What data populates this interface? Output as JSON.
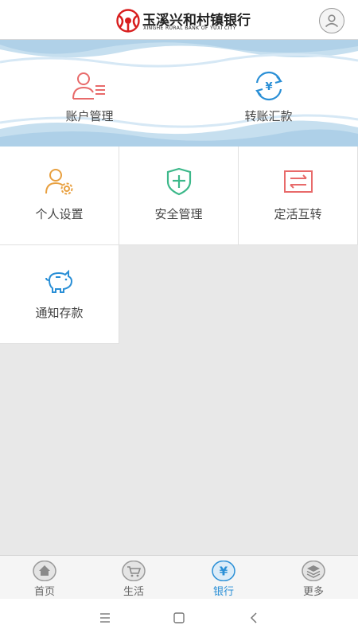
{
  "header": {
    "bank_name_cn": "玉溪兴和村镇银行",
    "bank_name_en": "XINGHE RURAL BANK OF YUXI CITY",
    "logo_icon": "bank-logo-icon",
    "avatar_icon": "user-avatar-icon"
  },
  "banner": {
    "items": [
      {
        "label": "账户管理",
        "icon": "account-card-icon",
        "color": "#e86a6a"
      },
      {
        "label": "转账汇款",
        "icon": "transfer-yuan-icon",
        "color": "#2a8fd6"
      }
    ]
  },
  "grid": {
    "items": [
      {
        "label": "个人设置",
        "icon": "user-settings-icon",
        "color": "#e8a040"
      },
      {
        "label": "安全管理",
        "icon": "shield-icon",
        "color": "#3cb88a"
      },
      {
        "label": "定活互转",
        "icon": "exchange-arrows-icon",
        "color": "#e86a6a"
      },
      {
        "label": "通知存款",
        "icon": "piggy-bank-icon",
        "color": "#2a8fd6"
      }
    ]
  },
  "tabbar": {
    "items": [
      {
        "label": "首页",
        "icon": "home-icon",
        "active": false
      },
      {
        "label": "生活",
        "icon": "cart-icon",
        "active": false
      },
      {
        "label": "银行",
        "icon": "yuan-icon",
        "active": true
      },
      {
        "label": "更多",
        "icon": "layers-icon",
        "active": false
      }
    ],
    "active_color": "#2a8fd6"
  },
  "system_nav": {
    "items": [
      {
        "icon": "menu-icon"
      },
      {
        "icon": "home-square-icon"
      },
      {
        "icon": "back-icon"
      }
    ]
  }
}
